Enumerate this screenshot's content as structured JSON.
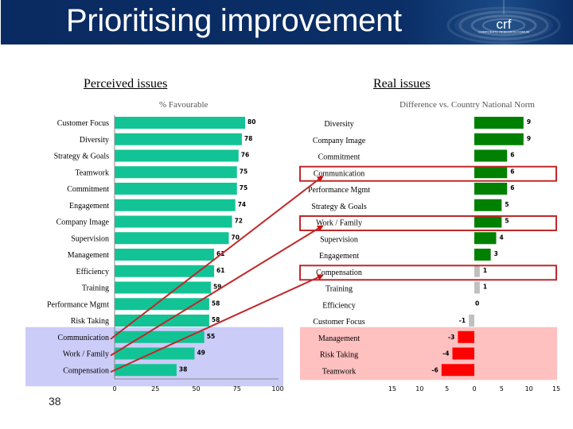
{
  "header": {
    "title": "Prioritising improvement",
    "logo_text": "crf",
    "logo_subtext": "CORPORATE RESEARCH FORUM"
  },
  "page_number": "38",
  "colors": {
    "header_bg": "#0b2e66",
    "perceived_bar": "#12c495",
    "positive_bar": "#008000",
    "neutral_bar": "#c0c0c0",
    "negative_bar": "#ff0000",
    "perceived_highlight_band": "#ccccf8",
    "real_highlight_band": "#ffc0c0",
    "annotation": "#c0282a",
    "axis": "#888888"
  },
  "chart_data": [
    {
      "type": "bar",
      "orientation": "horizontal",
      "title": "Perceived issues",
      "subtitle": "% Favourable",
      "xlabel": "",
      "ylabel": "",
      "xlim": [
        0,
        100
      ],
      "xticks": [
        0,
        25,
        50,
        75,
        100
      ],
      "xtick_labels": [
        "0",
        "25",
        "50",
        "75",
        "100"
      ],
      "grid": false,
      "legend": "none",
      "categories": [
        "Customer Focus",
        "Diversity",
        "Strategy & Goals",
        "Teamwork",
        "Commitment",
        "Engagement",
        "Company Image",
        "Supervision",
        "Management",
        "Efficiency",
        "Training",
        "Performance Mgmt",
        "Risk Taking",
        "Communication",
        "Work / Family",
        "Compensation"
      ],
      "values": [
        80,
        78,
        76,
        75,
        75,
        74,
        72,
        70,
        61,
        61,
        59,
        58,
        58,
        55,
        49,
        38
      ],
      "value_labels": [
        "80",
        "78",
        "76",
        "75",
        "75",
        "74",
        "72",
        "70",
        "61",
        "61",
        "59",
        "58",
        "58",
        "55",
        "49",
        "38"
      ],
      "highlight_categories": [
        "Communication",
        "Work / Family",
        "Compensation"
      ]
    },
    {
      "type": "bar",
      "orientation": "horizontal",
      "title": "Real issues",
      "subtitle": "Difference vs. Country National Norm",
      "xlabel": "",
      "ylabel": "",
      "xlim": [
        -15,
        15
      ],
      "xticks": [
        -15,
        -10,
        -5,
        0,
        5,
        10,
        15
      ],
      "xtick_labels": [
        "15",
        "10",
        "5",
        "0",
        "5",
        "10",
        "15"
      ],
      "grid": false,
      "legend": "none",
      "categories": [
        "Diversity",
        "Company Image",
        "Commitment",
        "Communication",
        "Performance Mgmt",
        "Strategy & Goals",
        "Work / Family",
        "Supervision",
        "Engagement",
        "Compensation",
        "Training",
        "Efficiency",
        "Customer Focus",
        "Management",
        "Risk Taking",
        "Teamwork"
      ],
      "values": [
        9,
        9,
        6,
        6,
        6,
        5,
        5,
        4,
        3,
        1,
        1,
        0,
        -1,
        -3,
        -4,
        -6
      ],
      "value_labels": [
        "9",
        "9",
        "6",
        "6",
        "6",
        "5",
        "5",
        "4",
        "3",
        "1",
        "1",
        "0",
        "-1",
        "-3",
        "-4",
        "-6"
      ],
      "bar_status": [
        "positive",
        "positive",
        "positive",
        "positive",
        "positive",
        "positive",
        "positive",
        "positive",
        "positive",
        "neutral",
        "neutral",
        "neutral",
        "neutral",
        "negative",
        "negative",
        "negative"
      ],
      "boxed_categories": [
        "Communication",
        "Work / Family",
        "Compensation"
      ],
      "highlight_categories": [
        "Management",
        "Risk Taking",
        "Teamwork"
      ]
    }
  ],
  "annotations": {
    "arrows": [
      {
        "from": "Communication",
        "to": "Communication"
      },
      {
        "from": "Work / Family",
        "to": "Work / Family"
      },
      {
        "from": "Compensation",
        "to": "Compensation"
      }
    ]
  }
}
